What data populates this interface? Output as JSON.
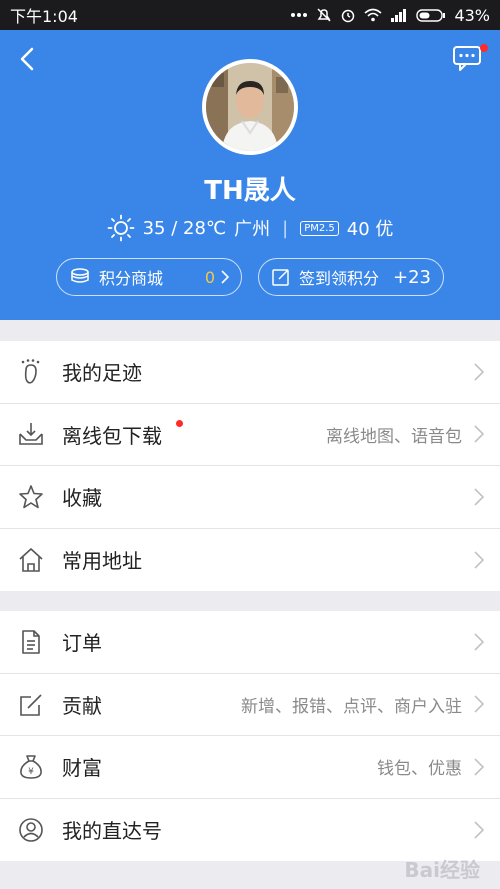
{
  "status_bar": {
    "time": "下午1:04",
    "battery": "43%"
  },
  "profile": {
    "name": "TH晟人",
    "weather": {
      "temp": "35 / 28℃",
      "city": "广州",
      "pm_label": "PM2.5",
      "aqi": "40 优"
    },
    "points_mall": {
      "label": "积分商城",
      "value": "0"
    },
    "checkin": {
      "label": "签到领积分",
      "value": "+23"
    }
  },
  "menu_group_1": [
    {
      "icon": "footprint-icon",
      "label": "我的足迹",
      "sub": ""
    },
    {
      "icon": "download-icon",
      "label": "离线包下载",
      "sub": "离线地图、语音包",
      "badge": true
    },
    {
      "icon": "star-icon",
      "label": "收藏",
      "sub": ""
    },
    {
      "icon": "home-icon",
      "label": "常用地址",
      "sub": ""
    }
  ],
  "menu_group_2": [
    {
      "icon": "order-icon",
      "label": "订单",
      "sub": ""
    },
    {
      "icon": "edit-icon",
      "label": "贡献",
      "sub": "新增、报错、点评、商户入驻"
    },
    {
      "icon": "money-bag-icon",
      "label": "财富",
      "sub": "钱包、优惠"
    },
    {
      "icon": "user-circle-icon",
      "label": "我的直达号",
      "sub": ""
    }
  ],
  "watermark": "Bai经验",
  "colors": {
    "header": "#3a86e8",
    "accent_yellow": "#f3c84a",
    "badge": "#ff2b2b"
  }
}
